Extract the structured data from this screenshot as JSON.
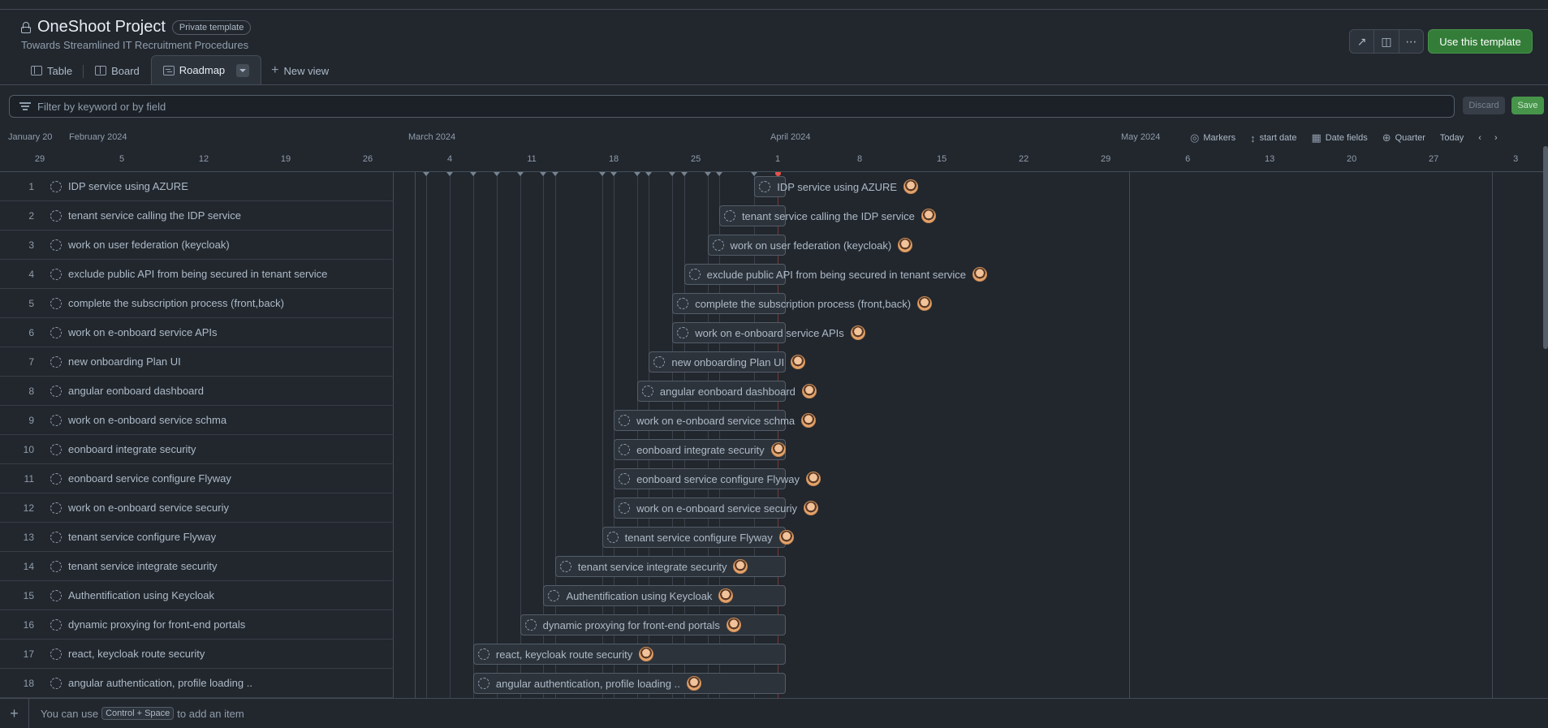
{
  "header": {
    "title": "OneShoot Project",
    "badge": "Private template",
    "subtitle": "Towards Streamlined IT Recruitment Procedures",
    "use_template": "Use this template"
  },
  "tabs": [
    {
      "label": "Table",
      "icon": "table-icon"
    },
    {
      "label": "Board",
      "icon": "board-icon"
    },
    {
      "label": "Roadmap",
      "icon": "roadmap-icon",
      "active": true
    }
  ],
  "new_view": "New view",
  "filter": {
    "placeholder": "Filter by keyword or by field",
    "discard": "Discard",
    "save": "Save"
  },
  "timeline": {
    "months": [
      "January 20",
      "February 2024",
      "March 2024",
      "April 2024",
      "May 2024"
    ],
    "days": [
      "29",
      "5",
      "12",
      "19",
      "26",
      "4",
      "11",
      "18",
      "25",
      "1",
      "8",
      "15",
      "22",
      "29",
      "6",
      "13",
      "20",
      "27",
      "3"
    ],
    "controls": {
      "markers": "Markers",
      "start_date": "start date",
      "date_fields": "Date fields",
      "zoom": "Quarter",
      "today": "Today"
    }
  },
  "items": [
    {
      "n": "1",
      "title": "IDP service using AZURE",
      "start": "2024-03-30"
    },
    {
      "n": "2",
      "title": "tenant service calling the IDP service",
      "start": "2024-03-27"
    },
    {
      "n": "3",
      "title": "work on user federation (keycloak)",
      "start": "2024-03-26"
    },
    {
      "n": "4",
      "title": "exclude public API from being secured in tenant service",
      "start": "2024-03-24"
    },
    {
      "n": "5",
      "title": "complete the subscription process (front,back)",
      "start": "2024-03-23"
    },
    {
      "n": "6",
      "title": "work on e-onboard service APIs",
      "start": "2024-03-23"
    },
    {
      "n": "7",
      "title": "new onboarding Plan UI",
      "start": "2024-03-21"
    },
    {
      "n": "8",
      "title": "angular eonboard dashboard",
      "start": "2024-03-20"
    },
    {
      "n": "9",
      "title": "work on e-onboard service schma",
      "start": "2024-03-18"
    },
    {
      "n": "10",
      "title": "eonboard integrate security",
      "start": "2024-03-18"
    },
    {
      "n": "11",
      "title": "eonboard service configure Flyway",
      "start": "2024-03-18"
    },
    {
      "n": "12",
      "title": "work on e-onboard service securiy",
      "start": "2024-03-18"
    },
    {
      "n": "13",
      "title": "tenant service configure Flyway",
      "start": "2024-03-17"
    },
    {
      "n": "14",
      "title": "tenant service integrate security",
      "start": "2024-03-13"
    },
    {
      "n": "15",
      "title": "Authentification using Keycloak",
      "start": "2024-03-12"
    },
    {
      "n": "16",
      "title": "dynamic proxying for front-end portals",
      "start": "2024-03-10"
    },
    {
      "n": "17",
      "title": "react, keycloak route security",
      "start": "2024-03-06"
    },
    {
      "n": "18",
      "title": "angular authentication, profile loading ..",
      "start": "2024-03-06"
    }
  ],
  "footer": {
    "prefix": "You can use",
    "shortcut": "Control + Space",
    "suffix": "to add an item"
  }
}
